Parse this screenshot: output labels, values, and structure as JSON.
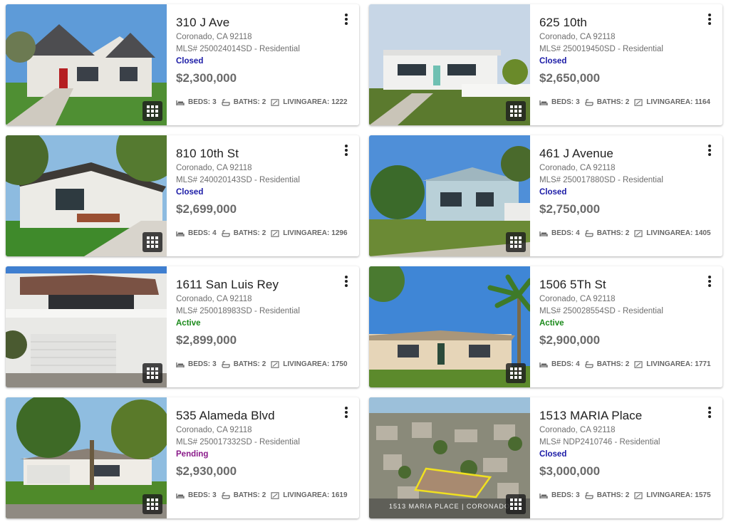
{
  "icons": {
    "menu": "more-vert-icon",
    "gallery": "grid-gallery-icon",
    "beds": "bed-icon",
    "baths": "bathtub-icon",
    "area": "area-icon"
  },
  "colors": {
    "closed": "#1a1aa6",
    "active": "#1b8a1b",
    "pending": "#8a1b8a"
  },
  "labels": {
    "beds": "BEDS:",
    "baths": "BATHS:",
    "area": "LIVINGAREA:"
  },
  "listings": [
    {
      "address": "310 J Ave",
      "city": "Coronado, CA 92118",
      "mls": "MLS# 250024014SD - Residential",
      "status": "Closed",
      "status_key": "closed",
      "price": "$2,300,000",
      "beds": "3",
      "baths": "2",
      "area": "1222",
      "photo_caption": ""
    },
    {
      "address": "625 10th",
      "city": "Coronado, CA 92118",
      "mls": "MLS# 250019450SD - Residential",
      "status": "Closed",
      "status_key": "closed",
      "price": "$2,650,000",
      "beds": "3",
      "baths": "2",
      "area": "1164",
      "photo_caption": ""
    },
    {
      "address": "810 10th St",
      "city": "Coronado, CA 92118",
      "mls": "MLS# 240020143SD - Residential",
      "status": "Closed",
      "status_key": "closed",
      "price": "$2,699,000",
      "beds": "4",
      "baths": "2",
      "area": "1296",
      "photo_caption": ""
    },
    {
      "address": "461 J Avenue",
      "city": "Coronado, CA 92118",
      "mls": "MLS# 250017880SD - Residential",
      "status": "Closed",
      "status_key": "closed",
      "price": "$2,750,000",
      "beds": "4",
      "baths": "2",
      "area": "1405",
      "photo_caption": ""
    },
    {
      "address": "1611 San Luis Rey",
      "city": "Coronado, CA 92118",
      "mls": "MLS# 250018983SD - Residential",
      "status": "Active",
      "status_key": "active",
      "price": "$2,899,000",
      "beds": "3",
      "baths": "2",
      "area": "1750",
      "photo_caption": ""
    },
    {
      "address": "1506 5Th St",
      "city": "Coronado, CA 92118",
      "mls": "MLS# 250028554SD - Residential",
      "status": "Active",
      "status_key": "active",
      "price": "$2,900,000",
      "beds": "4",
      "baths": "2",
      "area": "1771",
      "photo_caption": ""
    },
    {
      "address": "535 Alameda Blvd",
      "city": "Coronado, CA 92118",
      "mls": "MLS# 250017332SD - Residential",
      "status": "Pending",
      "status_key": "pending",
      "price": "$2,930,000",
      "beds": "3",
      "baths": "2",
      "area": "1619",
      "photo_caption": ""
    },
    {
      "address": "1513 MARIA Place",
      "city": "Coronado, CA 92118",
      "mls": "MLS# NDP2410746 - Residential",
      "status": "Closed",
      "status_key": "closed",
      "price": "$3,000,000",
      "beds": "3",
      "baths": "2",
      "area": "1575",
      "photo_caption": "1513 MARIA PLACE | CORONADO"
    }
  ]
}
